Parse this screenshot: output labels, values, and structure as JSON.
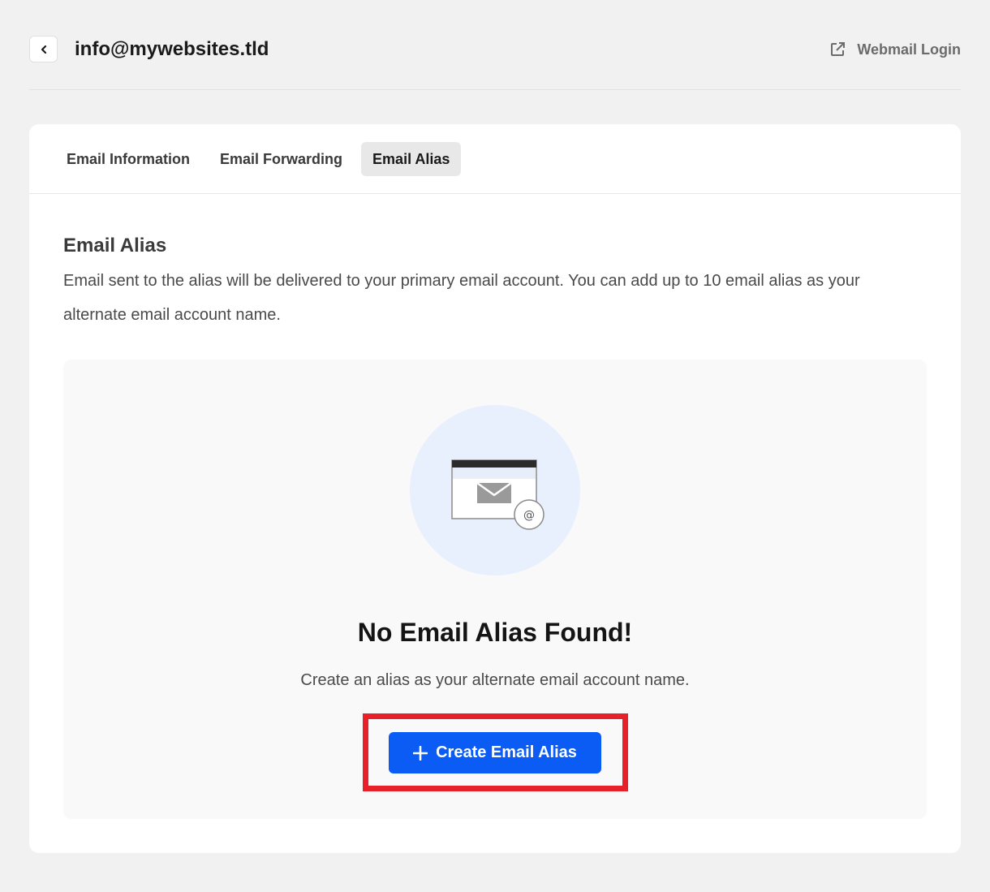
{
  "header": {
    "title": "info@mywebsites.tld",
    "back_icon": "chevron-left-icon",
    "webmail_label": "Webmail Login",
    "webmail_icon": "external-link-icon"
  },
  "tabs": [
    {
      "label": "Email Information",
      "active": false
    },
    {
      "label": "Email Forwarding",
      "active": false
    },
    {
      "label": "Email Alias",
      "active": true
    }
  ],
  "section": {
    "title": "Email Alias",
    "description": "Email sent to the alias will be delivered to your primary email account. You can add up to 10 email alias as your alternate email account name."
  },
  "empty_state": {
    "illustration_icon": "email-alias-icon",
    "at_symbol": "@",
    "title": "No Email Alias Found!",
    "description": "Create an alias as your alternate email account name.",
    "button_label": "Create Email Alias",
    "button_icon": "plus-icon"
  },
  "colors": {
    "accent": "#0a5cf5",
    "highlight": "#e8202a",
    "background": "#f1f1f1"
  }
}
